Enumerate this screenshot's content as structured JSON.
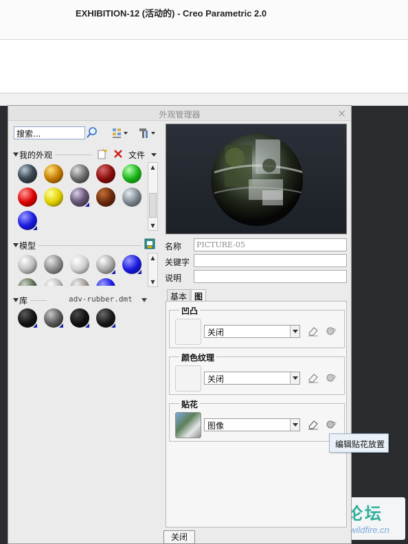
{
  "window": {
    "title": "EXHIBITION-12 (活动的) - Creo Parametric 2.0"
  },
  "dialog": {
    "title": "外观管理器",
    "close_glyph": "×",
    "search": {
      "value": "搜索..."
    },
    "sections": {
      "my_appearances": {
        "label": "我的外观",
        "file_menu_label": "文件"
      },
      "model": {
        "label": "模型"
      },
      "library": {
        "label": "库",
        "file": "adv-rubber.dmt"
      }
    },
    "fields": {
      "name_label": "名称",
      "name_value": "PICTURE-05",
      "keyword_label": "关键字",
      "keyword_value": "",
      "description_label": "说明",
      "description_value": ""
    },
    "tabs": {
      "basic": "基本",
      "map": "图"
    },
    "groups": {
      "bump": {
        "title": "凹凸",
        "value": "关闭"
      },
      "color_texture": {
        "title": "颜色纹理",
        "value": "关闭"
      },
      "decal": {
        "title": "贴花",
        "value": "图像"
      }
    },
    "tooltip": "编辑贴花放置",
    "close_button": "关闭"
  },
  "watermark": {
    "title": "野火论坛",
    "url": "www.proewildfire.cn"
  }
}
